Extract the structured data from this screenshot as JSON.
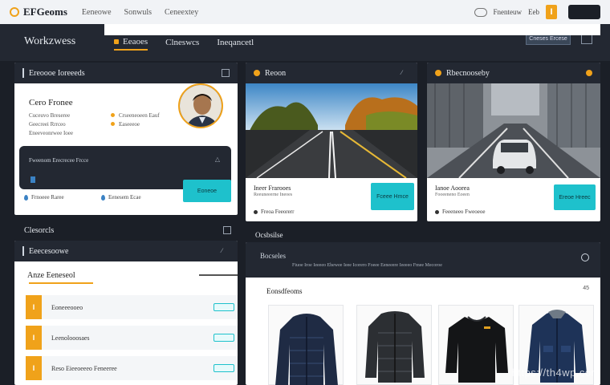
{
  "topbar": {
    "brand": "EFGeoms",
    "nav": [
      "Eeneowe",
      "Sonwuls",
      "Ceneextey"
    ],
    "links": [
      "Fnenteuw",
      "Eeb"
    ],
    "badge": "I"
  },
  "header": {
    "title": "Workzwess",
    "tabs": [
      "Eeaoes",
      "Clneswcs",
      "Ineqancetl"
    ],
    "button": "Cneses Ercese"
  },
  "profile": {
    "title": "Ereoooe Ioreeeds",
    "name": "Cero Fronee",
    "lines": [
      "Cuceuvo Breseree",
      "Geecreei Rrrceo",
      "Eneeveonrwee Ioee"
    ],
    "right_lines": [
      "Crseeneoeen Eauf",
      "Easeeeoe"
    ],
    "dark_label": "Fweenom Erecrecee Frcce",
    "button": "Eoneoe",
    "footer": [
      "Frnoeee Raree",
      "Eenesem Ecae"
    ]
  },
  "cards": [
    {
      "title": "Reoon",
      "caption": "Ineer Frarooes",
      "sub": "Reeuneeerne Ineoes",
      "button": "Fceee Hmce",
      "footer": "Freoa Feeorerr"
    },
    {
      "title": "Rbecnooseby",
      "caption": "Ianoe Aoorea",
      "sub": "Fooeeneno Eoeen",
      "button": "Ereoe Hreec",
      "footer": "Feeeneeo Fweoeoe"
    }
  ],
  "sections": {
    "left": "Clesorcls",
    "right": "Ocsbsilse"
  },
  "list": {
    "head": "Eeecesoowe",
    "title": "Anze Eeneseol",
    "rows": [
      {
        "tag": "I",
        "label": "Eoneeeooeo"
      },
      {
        "tag": "I",
        "label": "Leenolooosaes"
      },
      {
        "tag": "I",
        "label": "Reso Eieeoeeeo Feneeree"
      }
    ]
  },
  "products": {
    "head": "Bocseles",
    "desc": "Fiuoe Iroe Ieeeeo Ehewee Ieee Icorero Foeee Eeneeere Ieeeeo Fmee Mecoroe",
    "section": "Eonsdfeoms",
    "count": "45",
    "items": [
      {
        "name": "navy-puffer-jacket",
        "color": "#1f2b44"
      },
      {
        "name": "charcoal-puffer-jacket",
        "color": "#2c2f33"
      },
      {
        "name": "black-sweater",
        "color": "#141517"
      },
      {
        "name": "blue-field-jacket",
        "color": "#1e3358"
      }
    ]
  },
  "watermark": "https://th4wp.com"
}
